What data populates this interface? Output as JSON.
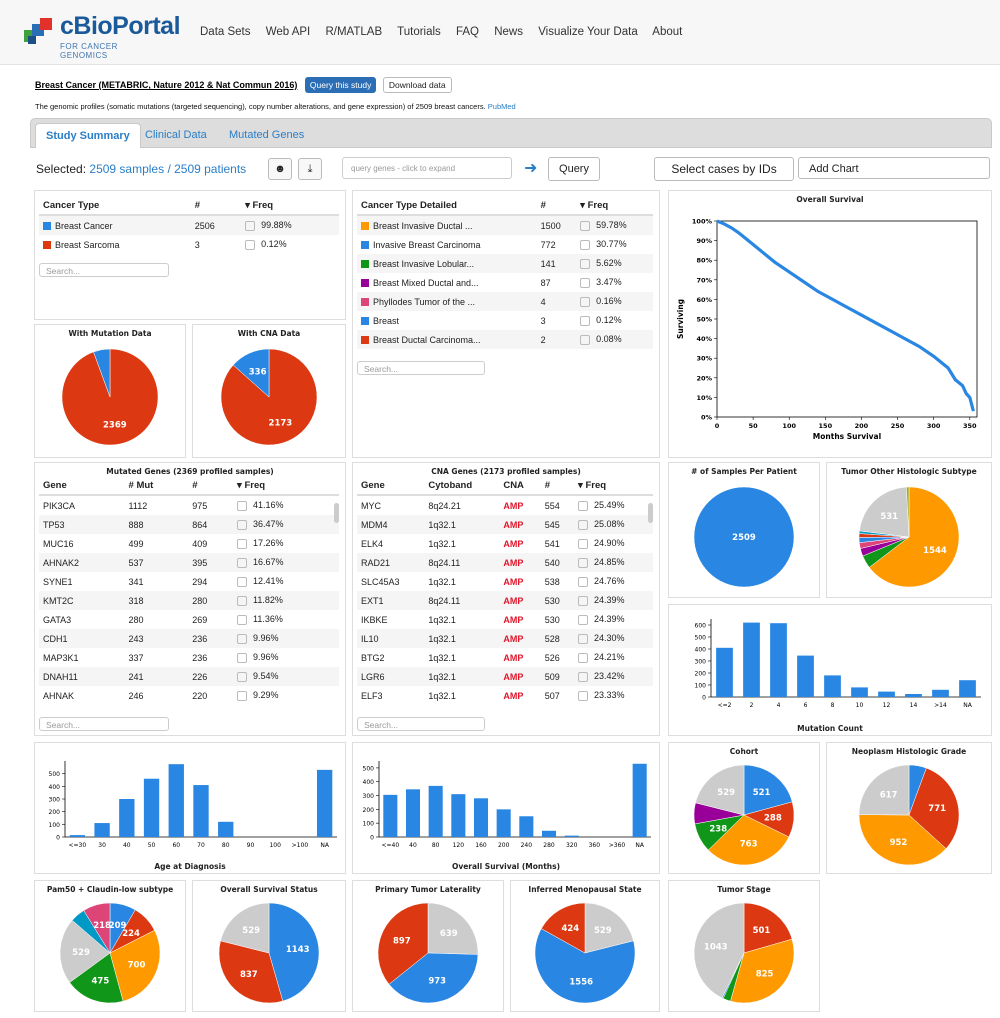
{
  "brand": {
    "name": "cBioPortal",
    "tagline": "FOR CANCER GENOMICS",
    "colors": {
      "blue": "#2986e2",
      "red": "#dc3912",
      "orange": "#ff9900",
      "green": "#109618",
      "purple": "#990099",
      "pink": "#dd4477",
      "gray": "#cccccc",
      "teal": "#0099c6"
    }
  },
  "nav": [
    "Data Sets",
    "Web API",
    "R/MATLAB",
    "Tutorials",
    "FAQ",
    "News",
    "Visualize Your Data",
    "About"
  ],
  "study": {
    "title": "Breast Cancer (METABRIC, Nature 2012 & Nat Commun 2016)",
    "query_btn": "Query this study",
    "download_btn": "Download data",
    "description": "The genomic profiles (somatic mutations (targeted sequencing), copy number alterations, and gene expression) of 2509 breast cancers.",
    "pubmed": "PubMed"
  },
  "tabs": [
    "Study Summary",
    "Clinical Data",
    "Mutated Genes"
  ],
  "toolbar": {
    "selected_prefix": "Selected:",
    "selected_value": "2509 samples / 2509 patients",
    "query_placeholder": "query genes - click to expand",
    "query_btn": "Query",
    "select_cases": "Select cases by IDs",
    "add_chart": "Add Chart",
    "user_icon": "user-icon",
    "download_icon": "download-icon",
    "arrow_icon": "arrow-right-icon"
  },
  "search_placeholder": "Search...",
  "cancer_type": {
    "headers": [
      "Cancer Type",
      "#",
      "Freq"
    ],
    "rows": [
      {
        "name": "Breast Cancer",
        "color": "#2986e2",
        "count": "2506",
        "freq": "99.88%"
      },
      {
        "name": "Breast Sarcoma",
        "color": "#dc3912",
        "count": "3",
        "freq": "0.12%"
      }
    ]
  },
  "cancer_type_detailed": {
    "headers": [
      "Cancer Type Detailed",
      "#",
      "Freq"
    ],
    "rows": [
      {
        "name": "Breast Invasive Ductal ...",
        "color": "#ff9900",
        "count": "1500",
        "freq": "59.78%"
      },
      {
        "name": "Invasive Breast Carcinoma",
        "color": "#2986e2",
        "count": "772",
        "freq": "30.77%"
      },
      {
        "name": "Breast Invasive Lobular...",
        "color": "#109618",
        "count": "141",
        "freq": "5.62%"
      },
      {
        "name": "Breast Mixed Ductal and...",
        "color": "#990099",
        "count": "87",
        "freq": "3.47%"
      },
      {
        "name": "Phyllodes Tumor of the ...",
        "color": "#dd4477",
        "count": "4",
        "freq": "0.16%"
      },
      {
        "name": "Breast",
        "color": "#2986e2",
        "count": "3",
        "freq": "0.12%"
      },
      {
        "name": "Breast Ductal Carcinoma...",
        "color": "#dc3912",
        "count": "2",
        "freq": "0.08%"
      }
    ]
  },
  "mutated_genes": {
    "title": "Mutated Genes (2369 profiled samples)",
    "headers": [
      "Gene",
      "# Mut",
      "#",
      "Freq"
    ],
    "rows": [
      {
        "gene": "PIK3CA",
        "mut": "1112",
        "n": "975",
        "freq": "41.16%"
      },
      {
        "gene": "TP53",
        "mut": "888",
        "n": "864",
        "freq": "36.47%"
      },
      {
        "gene": "MUC16",
        "mut": "499",
        "n": "409",
        "freq": "17.26%"
      },
      {
        "gene": "AHNAK2",
        "mut": "537",
        "n": "395",
        "freq": "16.67%"
      },
      {
        "gene": "SYNE1",
        "mut": "341",
        "n": "294",
        "freq": "12.41%"
      },
      {
        "gene": "KMT2C",
        "mut": "318",
        "n": "280",
        "freq": "11.82%"
      },
      {
        "gene": "GATA3",
        "mut": "280",
        "n": "269",
        "freq": "11.36%"
      },
      {
        "gene": "CDH1",
        "mut": "243",
        "n": "236",
        "freq": "9.96%"
      },
      {
        "gene": "MAP3K1",
        "mut": "337",
        "n": "236",
        "freq": "9.96%"
      },
      {
        "gene": "DNAH11",
        "mut": "241",
        "n": "226",
        "freq": "9.54%"
      },
      {
        "gene": "AHNAK",
        "mut": "246",
        "n": "220",
        "freq": "9.29%"
      }
    ]
  },
  "cna_genes": {
    "title": "CNA Genes (2173 profiled samples)",
    "headers": [
      "Gene",
      "Cytoband",
      "CNA",
      "#",
      "Freq"
    ],
    "rows": [
      {
        "gene": "MYC",
        "cyto": "8q24.21",
        "cna": "AMP",
        "n": "554",
        "freq": "25.49%"
      },
      {
        "gene": "MDM4",
        "cyto": "1q32.1",
        "cna": "AMP",
        "n": "545",
        "freq": "25.08%"
      },
      {
        "gene": "ELK4",
        "cyto": "1q32.1",
        "cna": "AMP",
        "n": "541",
        "freq": "24.90%"
      },
      {
        "gene": "RAD21",
        "cyto": "8q24.11",
        "cna": "AMP",
        "n": "540",
        "freq": "24.85%"
      },
      {
        "gene": "SLC45A3",
        "cyto": "1q32.1",
        "cna": "AMP",
        "n": "538",
        "freq": "24.76%"
      },
      {
        "gene": "EXT1",
        "cyto": "8q24.11",
        "cna": "AMP",
        "n": "530",
        "freq": "24.39%"
      },
      {
        "gene": "IKBKE",
        "cyto": "1q32.1",
        "cna": "AMP",
        "n": "530",
        "freq": "24.39%"
      },
      {
        "gene": "IL10",
        "cyto": "1q32.1",
        "cna": "AMP",
        "n": "528",
        "freq": "24.30%"
      },
      {
        "gene": "BTG2",
        "cyto": "1q32.1",
        "cna": "AMP",
        "n": "526",
        "freq": "24.21%"
      },
      {
        "gene": "LGR6",
        "cyto": "1q32.1",
        "cna": "AMP",
        "n": "509",
        "freq": "23.42%"
      },
      {
        "gene": "ELF3",
        "cyto": "1q32.1",
        "cna": "AMP",
        "n": "507",
        "freq": "23.33%"
      }
    ]
  },
  "chart_data": [
    {
      "id": "mutation",
      "type": "pie",
      "title": "With Mutation Data",
      "slices": [
        {
          "value": 2369,
          "color": "#dc3912",
          "label": "2369"
        },
        {
          "value": 140,
          "color": "#2986e2",
          "label": ""
        }
      ]
    },
    {
      "id": "cna",
      "type": "pie",
      "title": "With CNA Data",
      "slices": [
        {
          "value": 2173,
          "color": "#dc3912",
          "label": "2173"
        },
        {
          "value": 336,
          "color": "#2986e2",
          "label": "336"
        }
      ]
    },
    {
      "id": "survival",
      "type": "line",
      "title": "Overall Survival",
      "xlabel": "Months Survival",
      "ylabel": "Surviving",
      "xticks": [
        0,
        50,
        100,
        150,
        200,
        250,
        300,
        350
      ],
      "yticks": [
        "0%",
        "10%",
        "20%",
        "30%",
        "40%",
        "50%",
        "60%",
        "70%",
        "80%",
        "90%",
        "100%"
      ],
      "xlim": [
        0,
        360
      ],
      "ylim": [
        0,
        1
      ],
      "points": [
        [
          0,
          1.0
        ],
        [
          10,
          0.985
        ],
        [
          20,
          0.965
        ],
        [
          30,
          0.94
        ],
        [
          40,
          0.91
        ],
        [
          50,
          0.88
        ],
        [
          60,
          0.85
        ],
        [
          80,
          0.79
        ],
        [
          100,
          0.74
        ],
        [
          120,
          0.69
        ],
        [
          140,
          0.64
        ],
        [
          160,
          0.6
        ],
        [
          180,
          0.56
        ],
        [
          200,
          0.52
        ],
        [
          220,
          0.48
        ],
        [
          240,
          0.44
        ],
        [
          260,
          0.4
        ],
        [
          280,
          0.36
        ],
        [
          300,
          0.31
        ],
        [
          320,
          0.25
        ],
        [
          330,
          0.19
        ],
        [
          340,
          0.16
        ],
        [
          345,
          0.12
        ],
        [
          350,
          0.1
        ],
        [
          355,
          0.03
        ]
      ]
    },
    {
      "id": "samples_per_patient",
      "type": "pie",
      "title": "# of Samples Per Patient",
      "slices": [
        {
          "value": 2509,
          "color": "#2986e2",
          "label": "2509"
        }
      ]
    },
    {
      "id": "tumor_other",
      "type": "pie",
      "title": "Tumor Other Histologic Subtype",
      "slices": [
        {
          "value": 1544,
          "color": "#ff9900",
          "label": "1544"
        },
        {
          "value": 100,
          "color": "#109618",
          "label": ""
        },
        {
          "value": 60,
          "color": "#990099",
          "label": ""
        },
        {
          "value": 45,
          "color": "#dd4477",
          "label": ""
        },
        {
          "value": 40,
          "color": "#2986e2",
          "label": ""
        },
        {
          "value": 30,
          "color": "#dc3912",
          "label": ""
        },
        {
          "value": 20,
          "color": "#0099c6",
          "label": ""
        },
        {
          "value": 531,
          "color": "#cccccc",
          "label": "531"
        },
        {
          "value": 20,
          "color": "#aaaa11",
          "label": ""
        }
      ]
    },
    {
      "id": "mutation_count",
      "type": "bar",
      "title": "Mutation Count",
      "categories": [
        "<=2",
        "2",
        "4",
        "6",
        "8",
        "10",
        "12",
        "14",
        ">14",
        "NA"
      ],
      "values": [
        410,
        620,
        615,
        345,
        180,
        80,
        45,
        25,
        60,
        140
      ],
      "yticks": [
        0,
        100,
        200,
        300,
        400,
        500,
        600
      ],
      "ylim": [
        0,
        650
      ]
    },
    {
      "id": "age",
      "type": "bar",
      "title": "Age at Diagnosis",
      "categories": [
        "<=30",
        "30",
        "40",
        "50",
        "60",
        "70",
        "80",
        "90",
        "100",
        ">100",
        "NA"
      ],
      "values": [
        15,
        110,
        300,
        460,
        575,
        410,
        120,
        0,
        0,
        0,
        530
      ],
      "yticks": [
        0,
        100,
        200,
        300,
        400,
        500
      ],
      "ylim": [
        0,
        600
      ]
    },
    {
      "id": "os_months",
      "type": "bar",
      "title": "Overall Survival (Months)",
      "categories": [
        "<=40",
        "40",
        "80",
        "120",
        "160",
        "200",
        "240",
        "280",
        "320",
        "360",
        ">360",
        "NA"
      ],
      "values": [
        305,
        345,
        370,
        310,
        280,
        200,
        150,
        45,
        10,
        0,
        0,
        530
      ],
      "yticks": [
        0,
        100,
        200,
        300,
        400,
        500
      ],
      "ylim": [
        0,
        550
      ]
    },
    {
      "id": "cohort",
      "type": "pie",
      "title": "Cohort",
      "slices": [
        {
          "value": 521,
          "color": "#2986e2",
          "label": "521"
        },
        {
          "value": 288,
          "color": "#dc3912",
          "label": "288"
        },
        {
          "value": 763,
          "color": "#ff9900",
          "label": "763"
        },
        {
          "value": 238,
          "color": "#109618",
          "label": "238"
        },
        {
          "value": 170,
          "color": "#990099",
          "label": ""
        },
        {
          "value": 529,
          "color": "#cccccc",
          "label": "529"
        }
      ]
    },
    {
      "id": "grade",
      "type": "pie",
      "title": "Neoplasm Histologic Grade",
      "slices": [
        {
          "value": 140,
          "color": "#2986e2",
          "label": ""
        },
        {
          "value": 771,
          "color": "#dc3912",
          "label": "771"
        },
        {
          "value": 952,
          "color": "#ff9900",
          "label": "952"
        },
        {
          "value": 617,
          "color": "#cccccc",
          "label": "617"
        }
      ]
    },
    {
      "id": "pam50",
      "type": "pie",
      "title": "Pam50 + Claudin-low subtype",
      "slices": [
        {
          "value": 209,
          "color": "#2986e2",
          "label": "209"
        },
        {
          "value": 224,
          "color": "#dc3912",
          "label": "224"
        },
        {
          "value": 700,
          "color": "#ff9900",
          "label": "700"
        },
        {
          "value": 475,
          "color": "#109618",
          "label": "475"
        },
        {
          "value": 529,
          "color": "#cccccc",
          "label": "529"
        },
        {
          "value": 120,
          "color": "#0099c6",
          "label": ""
        },
        {
          "value": 218,
          "color": "#dd4477",
          "label": "218"
        }
      ]
    },
    {
      "id": "os_status",
      "type": "pie",
      "title": "Overall Survival Status",
      "slices": [
        {
          "value": 1143,
          "color": "#2986e2",
          "label": "1143"
        },
        {
          "value": 837,
          "color": "#dc3912",
          "label": "837"
        },
        {
          "value": 529,
          "color": "#cccccc",
          "label": "529"
        }
      ]
    },
    {
      "id": "laterality",
      "type": "pie",
      "title": "Primary Tumor Laterality",
      "slices": [
        {
          "value": 639,
          "color": "#cccccc",
          "label": "639"
        },
        {
          "value": 973,
          "color": "#2986e2",
          "label": "973"
        },
        {
          "value": 897,
          "color": "#dc3912",
          "label": "897"
        }
      ]
    },
    {
      "id": "menopause",
      "type": "pie",
      "title": "Inferred Menopausal State",
      "slices": [
        {
          "value": 529,
          "color": "#cccccc",
          "label": "529"
        },
        {
          "value": 1556,
          "color": "#2986e2",
          "label": "1556"
        },
        {
          "value": 424,
          "color": "#dc3912",
          "label": "424"
        }
      ]
    },
    {
      "id": "stage",
      "type": "pie",
      "title": "Tumor Stage",
      "slices": [
        {
          "value": 501,
          "color": "#dc3912",
          "label": "501"
        },
        {
          "value": 825,
          "color": "#ff9900",
          "label": "825"
        },
        {
          "value": 60,
          "color": "#109618",
          "label": ""
        },
        {
          "value": 10,
          "color": "#2986e2",
          "label": ""
        },
        {
          "value": 1043,
          "color": "#cccccc",
          "label": "1043"
        }
      ]
    }
  ]
}
